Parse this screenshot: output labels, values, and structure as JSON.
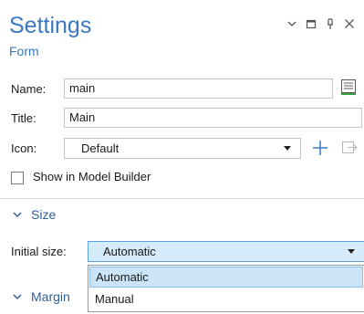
{
  "header": {
    "title": "Settings",
    "subtitle": "Form",
    "controls": [
      "chevron-down-icon",
      "maximize-icon",
      "pin-icon",
      "close-icon"
    ]
  },
  "form": {
    "name_label": "Name:",
    "name_value": "main",
    "title_label": "Title:",
    "title_value": "Main",
    "icon_label": "Icon:",
    "icon_value": "Default",
    "show_in_builder_label": "Show in Model Builder",
    "show_in_builder_checked": false
  },
  "size_section": {
    "title": "Size",
    "initial_size_label": "Initial size:",
    "initial_size_value": "Automatic",
    "options": [
      "Automatic",
      "Manual"
    ]
  },
  "margins_section": {
    "title": "Margin"
  },
  "colors": {
    "accent": "#3b78c2",
    "section": "#2f5f9a",
    "selection": "#cce4f7",
    "add_icon": "#3b78c2"
  }
}
